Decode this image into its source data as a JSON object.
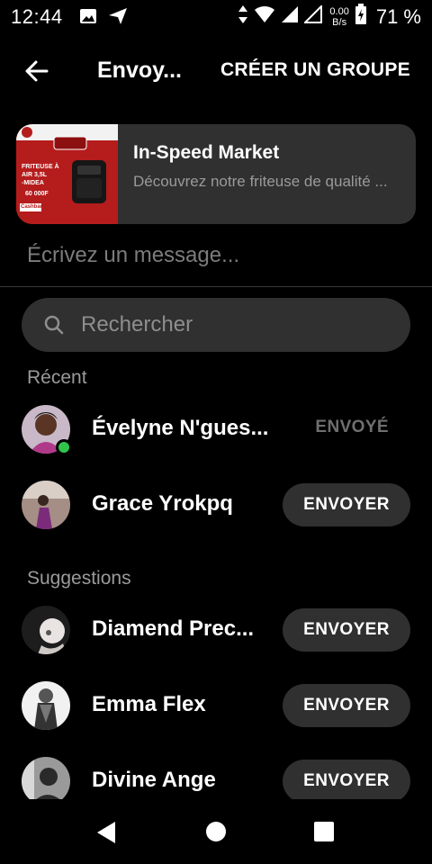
{
  "status_bar": {
    "time": "12:44",
    "net_speed_value": "0.00",
    "net_speed_unit": "B/s",
    "battery": "71 %"
  },
  "header": {
    "title": "Envoy...",
    "create_group": "CRÉER UN GROUPE"
  },
  "share_card": {
    "title": "In-Speed Market",
    "description": "Découvrez notre friteuse de qualité ...",
    "thumbnail_text": {
      "line1": "FRITEUSE À",
      "line2": "AIR 3,5L",
      "line3": "-MIDEA",
      "price": "60 000F",
      "cashback": "Cashback 3%"
    }
  },
  "message_placeholder": "Écrivez un message...",
  "search": {
    "placeholder": "Rechercher"
  },
  "sections": {
    "recent": "Récent",
    "suggestions": "Suggestions"
  },
  "recent": [
    {
      "name": "Évelyne N'gues...",
      "status": "ENVOYÉ",
      "online": true
    },
    {
      "name": "Grace Yrokpq",
      "action": "ENVOYER"
    }
  ],
  "suggestions": [
    {
      "name": "Diamend Prec...",
      "action": "ENVOYER"
    },
    {
      "name": "Emma Flex",
      "action": "ENVOYER"
    },
    {
      "name": "Divine Ange",
      "action": "ENVOYER"
    }
  ],
  "colors": {
    "background": "#000000",
    "surface": "#303030",
    "online": "#31c44a",
    "muted_text": "#9a9a9a"
  }
}
